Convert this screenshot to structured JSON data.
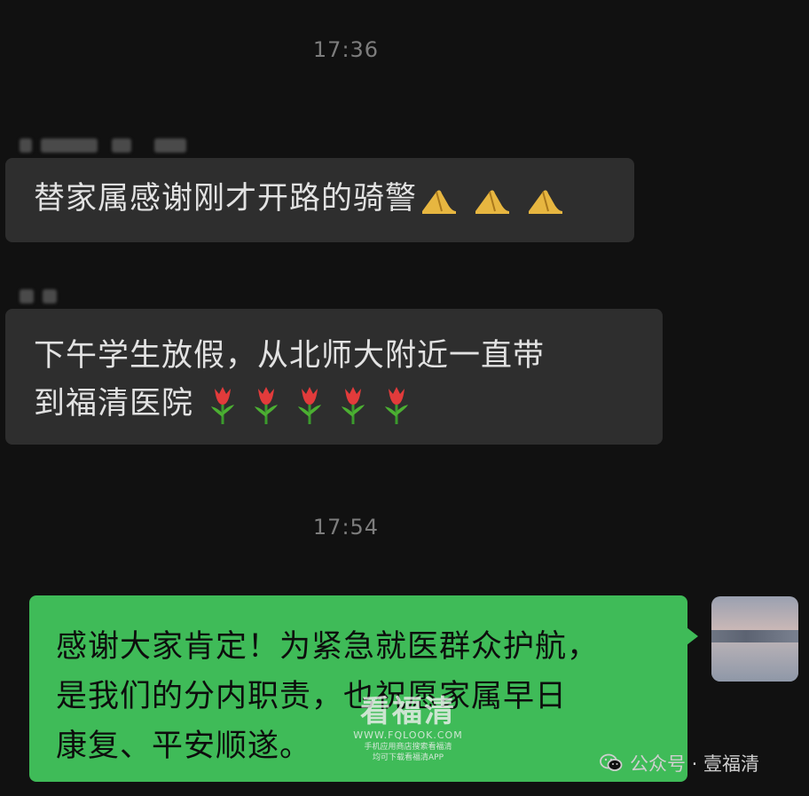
{
  "chat": {
    "messages": [
      {
        "timestamp": "17:36"
      },
      {
        "text": "替家属感谢刚才开路的骑警",
        "emoji": "folded-hands-icon",
        "emoji_count": 3
      },
      {
        "line1": "下午学生放假，从北师大附近一直带",
        "line2": "到福清医院",
        "emoji": "tulip-icon",
        "emoji_count": 5
      },
      {
        "timestamp": "17:54"
      },
      {
        "line1": "感谢大家肯定！为紧急就医群众护航，",
        "line2": "是我们的分内职责，也祝愿家属早日",
        "line3": "康复、平安顺遂。"
      }
    ]
  },
  "watermark": {
    "title": "看福清",
    "site": "WWW.FQLOOK.COM",
    "line1": "手机应用商店搜索看福清",
    "line2": "均可下载看福清APP"
  },
  "account": {
    "label": "公众号 · 壹福清",
    "icon": "wechat-icon"
  },
  "colors": {
    "background": "#111111",
    "incoming_bubble": "#2e2e2e",
    "outgoing_bubble": "#3fbb58",
    "timestamp": "#7d7d7d"
  }
}
